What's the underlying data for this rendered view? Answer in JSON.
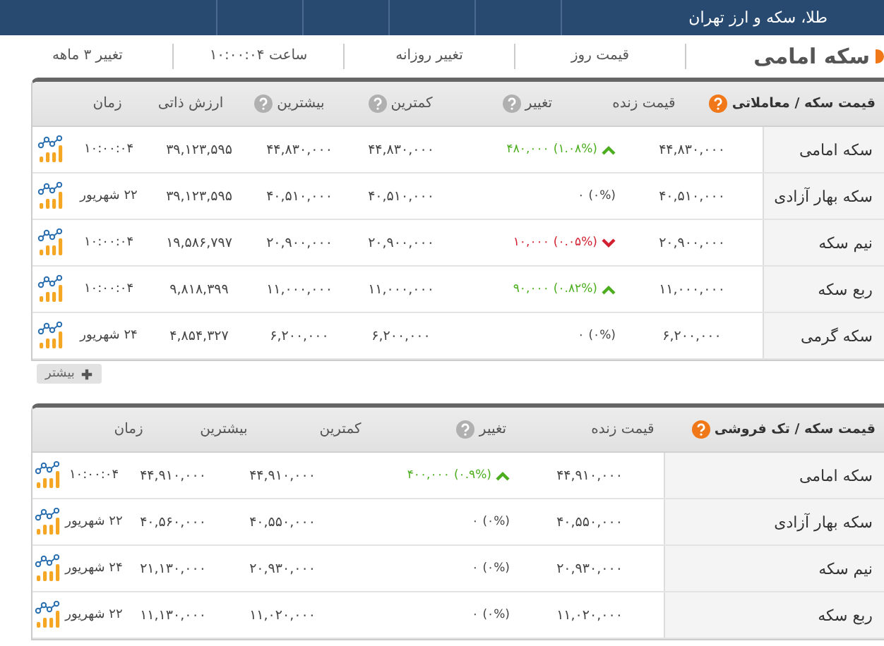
{
  "nav": {
    "title": "طلا، سکه و ارز تهران"
  },
  "coin": {
    "title": "سکه امامی",
    "stats": [
      {
        "label": "قیمت روز"
      },
      {
        "label": "تغییر روزانه"
      },
      {
        "label": "ساعت ۱۰:۰۰:۰۴"
      },
      {
        "label": "تغییر ۳ ماهه"
      }
    ]
  },
  "tables": [
    {
      "columns": [
        {
          "label": "قیمت سکه / معاملاتی",
          "help": true
        },
        {
          "label": "قیمت زنده",
          "help": false
        },
        {
          "label": "تغییر",
          "help": true
        },
        {
          "label": "کمترین",
          "help": true
        },
        {
          "label": "بیشترین",
          "help": true
        },
        {
          "label": "ارزش ذاتی",
          "help": false
        },
        {
          "label": "زمان",
          "help": false
        }
      ],
      "rows": [
        {
          "name": "سکه امامی",
          "price": "۴۴,۸۳۰,۰۰۰",
          "change": {
            "kind": "up",
            "percent": "(۱.۰۸%)",
            "amount": "۴۸۰,۰۰۰"
          },
          "cells": [
            "۴۴,۸۳۰,۰۰۰",
            "۴۴,۸۳۰,۰۰۰",
            "۳۹,۱۲۳,۵۹۵"
          ],
          "time": "۱۰:۰۰:۰۴"
        },
        {
          "name": "سکه بهار آزادی",
          "price": "۴۰,۵۱۰,۰۰۰",
          "change": {
            "kind": "flat",
            "percent": "(۰%)",
            "amount": "۰"
          },
          "cells": [
            "۴۰,۵۱۰,۰۰۰",
            "۴۰,۵۱۰,۰۰۰",
            "۳۹,۱۲۳,۵۹۵"
          ],
          "time": "۲۲ شهریور"
        },
        {
          "name": "نیم سکه",
          "price": "۲۰,۹۰۰,۰۰۰",
          "change": {
            "kind": "down",
            "percent": "(۰.۰۵%)",
            "amount": "۱۰,۰۰۰"
          },
          "cells": [
            "۲۰,۹۰۰,۰۰۰",
            "۲۰,۹۰۰,۰۰۰",
            "۱۹,۵۸۶,۷۹۷"
          ],
          "time": "۱۰:۰۰:۰۴"
        },
        {
          "name": "ربع سکه",
          "price": "۱۱,۰۰۰,۰۰۰",
          "change": {
            "kind": "up",
            "percent": "(۰.۸۲%)",
            "amount": "۹۰,۰۰۰"
          },
          "cells": [
            "۱۱,۰۰۰,۰۰۰",
            "۱۱,۰۰۰,۰۰۰",
            "۹,۸۱۸,۳۹۹"
          ],
          "time": "۱۰:۰۰:۰۴"
        },
        {
          "name": "سکه گرمی",
          "price": "۶,۲۰۰,۰۰۰",
          "change": {
            "kind": "flat",
            "percent": "(۰%)",
            "amount": "۰"
          },
          "cells": [
            "۶,۲۰۰,۰۰۰",
            "۶,۲۰۰,۰۰۰",
            "۴,۸۵۴,۳۲۷"
          ],
          "time": "۲۴ شهریور"
        }
      ],
      "more_button": "بیشتر"
    },
    {
      "columns": [
        {
          "label": "قیمت سکه / تک فروشی",
          "help": true
        },
        {
          "label": "قیمت زنده",
          "help": false
        },
        {
          "label": "تغییر",
          "help": true
        },
        {
          "label": "کمترین",
          "help": false
        },
        {
          "label": "بیشترین",
          "help": false
        },
        {
          "label": "زمان",
          "help": false
        }
      ],
      "rows": [
        {
          "name": "سکه امامی",
          "price": "۴۴,۹۱۰,۰۰۰",
          "change": {
            "kind": "up",
            "percent": "(۰.۹%)",
            "amount": "۴۰۰,۰۰۰"
          },
          "cells": [
            "۴۴,۹۱۰,۰۰۰",
            "۴۴,۹۱۰,۰۰۰"
          ],
          "time": "۱۰:۰۰:۰۴"
        },
        {
          "name": "سکه بهار آزادی",
          "price": "۴۰,۵۵۰,۰۰۰",
          "change": {
            "kind": "flat",
            "percent": "(۰%)",
            "amount": "۰"
          },
          "cells": [
            "۴۰,۵۵۰,۰۰۰",
            "۴۰,۵۶۰,۰۰۰"
          ],
          "time": "۲۲ شهریور"
        },
        {
          "name": "نیم سکه",
          "price": "۲۰,۹۳۰,۰۰۰",
          "change": {
            "kind": "flat",
            "percent": "(۰%)",
            "amount": "۰"
          },
          "cells": [
            "۲۰,۹۳۰,۰۰۰",
            "۲۱,۱۳۰,۰۰۰"
          ],
          "time": "۲۴ شهریور"
        },
        {
          "name": "ربع سکه",
          "price": "۱۱,۰۲۰,۰۰۰",
          "change": {
            "kind": "flat",
            "percent": "(۰%)",
            "amount": "۰"
          },
          "cells": [
            "۱۱,۰۲۰,۰۰۰",
            "۱۱,۱۳۰,۰۰۰"
          ],
          "time": "۲۲ شهریور"
        }
      ]
    }
  ]
}
